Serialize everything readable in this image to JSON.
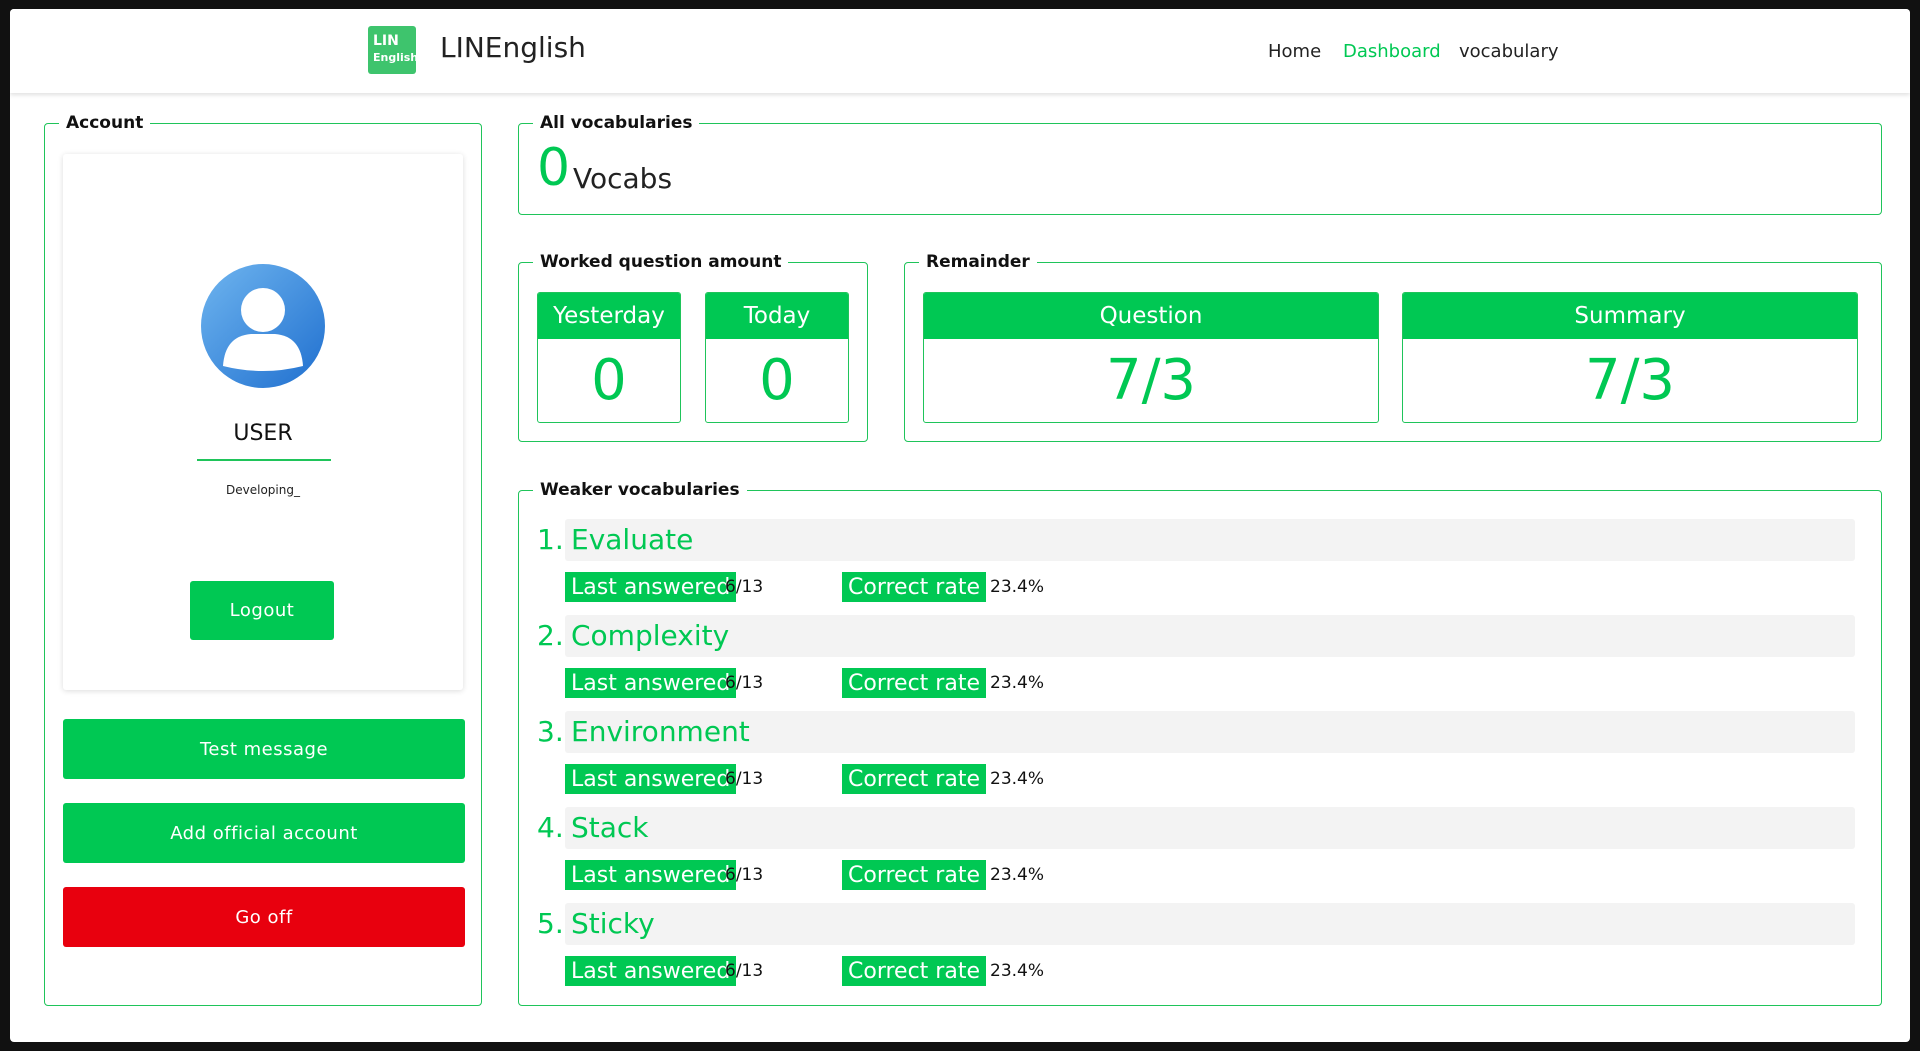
{
  "header": {
    "logo_line1": "LIN",
    "logo_line2": "English",
    "app_title": "LINEnglish",
    "nav": [
      {
        "label": "Home",
        "active": false
      },
      {
        "label": "Dashboard",
        "active": true
      },
      {
        "label": "vocabulary",
        "active": false
      }
    ]
  },
  "account": {
    "legend": "Account",
    "username": "USER",
    "status": "Developing_",
    "logout_label": "Logout",
    "buttons": [
      {
        "label": "Test message",
        "color": "#00c853"
      },
      {
        "label": "Add official account",
        "color": "#00c853"
      },
      {
        "label": "Go off",
        "color": "#e8000e"
      }
    ]
  },
  "all_vocab": {
    "legend": "All vocabularies",
    "count": "0",
    "unit": "Vocabs"
  },
  "worked": {
    "legend": "Worked question amount",
    "yesterday_label": "Yesterday",
    "yesterday_value": "0",
    "today_label": "Today",
    "today_value": "0"
  },
  "remainder": {
    "legend": "Remainder",
    "question_label": "Question",
    "question_value": "7/3",
    "summary_label": "Summary",
    "summary_value": "7/3"
  },
  "weak": {
    "legend": "Weaker vocabularies",
    "last_label": "Last answered",
    "rate_label": "Correct rate",
    "items": [
      {
        "num": "1.",
        "word": "Evaluate",
        "last": "6/13",
        "rate": "23.4%"
      },
      {
        "num": "2.",
        "word": "Complexity",
        "last": "6/13",
        "rate": "23.4%"
      },
      {
        "num": "3.",
        "word": "Environment",
        "last": "6/13",
        "rate": "23.4%"
      },
      {
        "num": "4.",
        "word": "Stack",
        "last": "6/13",
        "rate": "23.4%"
      },
      {
        "num": "5.",
        "word": "Sticky",
        "last": "6/13",
        "rate": "23.4%"
      }
    ]
  },
  "colors": {
    "accent": "#00c853",
    "danger": "#e8000e",
    "border": "#1fc45a"
  }
}
